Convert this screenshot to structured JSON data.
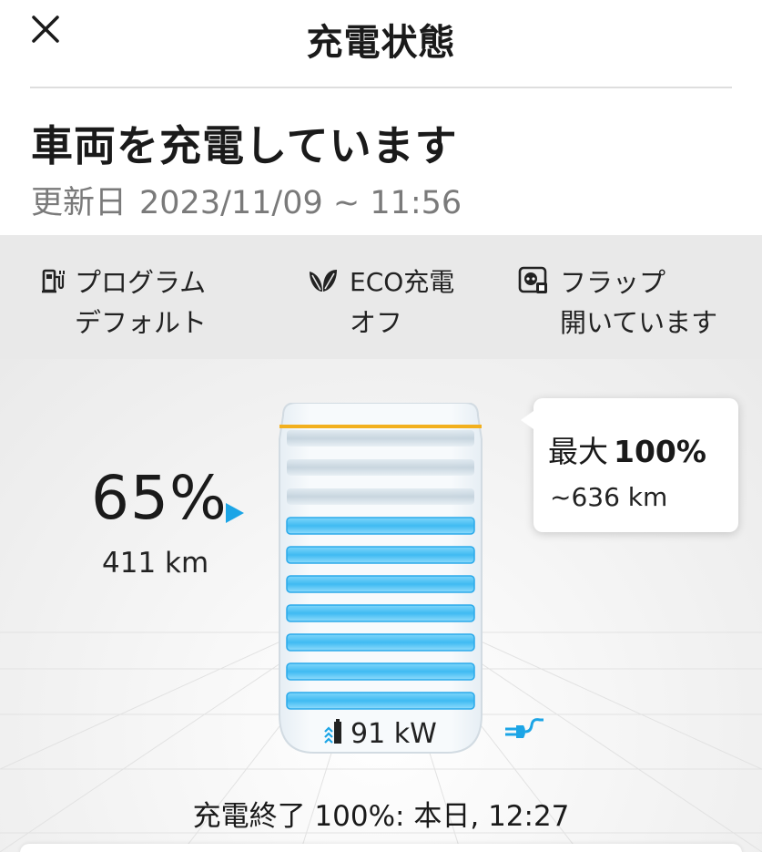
{
  "header": {
    "title": "充電状態",
    "close_icon": "close-icon"
  },
  "status": {
    "title": "車両を充電しています",
    "updated_label": "更新日",
    "updated_value": "2023/11/09 ~ 11:56"
  },
  "info_items": [
    {
      "icon": "charging-station-icon",
      "line1": "プログラム",
      "line2": "デフォルト"
    },
    {
      "icon": "leaf-icon",
      "line1": "ECO充電",
      "line2": "オフ"
    },
    {
      "icon": "charge-flap-icon",
      "line1": "フラップ",
      "line2": "開いています"
    }
  ],
  "battery": {
    "percent_text": "65%",
    "range_text": "411 km",
    "level": 0.65,
    "target_level": 1.0,
    "max_label": "最大",
    "max_value": "100%",
    "max_range": "~636 km",
    "power_text": "91 kW",
    "filled_bars": 7,
    "empty_bars": 3
  },
  "end_text": "充電終了 100%: 本日, 12:27",
  "colors": {
    "accent": "#1ca5e6",
    "bar_fill": "#4cc3f5",
    "target_line": "#f2b01e",
    "info_bg": "#e9e9e9"
  }
}
